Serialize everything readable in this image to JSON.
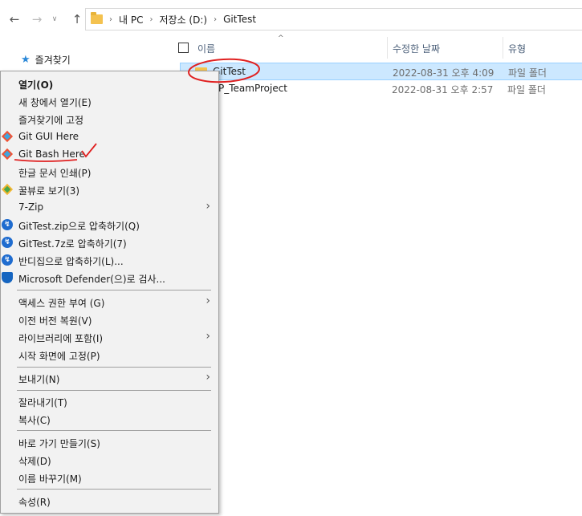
{
  "address": {
    "crumbs": [
      "내 PC",
      "저장소 (D:)",
      "GitTest"
    ],
    "separator": "›"
  },
  "nav": {
    "back": "←",
    "forward": "→",
    "recent": "∨",
    "up": "↑",
    "quick_access": "즐겨찾기"
  },
  "filelist": {
    "columns": {
      "name": "이름",
      "modified": "수정한 날짜",
      "type": "유형"
    },
    "rows": [
      {
        "name": "GitTest",
        "modified": "2022-08-31 오후 4:09",
        "type": "파일 폴더"
      },
      {
        "name": "P_TeamProject",
        "modified": "2022-08-31 오후 2:57",
        "type": "파일 폴더"
      }
    ]
  },
  "context_menu": {
    "items": [
      {
        "label": "열기(O)"
      },
      {
        "label": "새 창에서 열기(E)"
      },
      {
        "label": "즐겨찾기에 고정"
      },
      {
        "label": "Git GUI Here"
      },
      {
        "label": "Git Bash Here"
      },
      {
        "label": "한글 문서 인쇄(P)"
      },
      {
        "label": "꿀뷰로 보기(3)"
      },
      {
        "label": "7-Zip"
      },
      {
        "label": "GitTest.zip으로 압축하기(Q)"
      },
      {
        "label": "GitTest.7z로 압축하기(7)"
      },
      {
        "label": "반디집으로 압축하기(L)..."
      },
      {
        "label": "Microsoft Defender(으)로 검사..."
      },
      {
        "label": "액세스 권한 부여 (G)"
      },
      {
        "label": "이전 버전 복원(V)"
      },
      {
        "label": "라이브러리에 포함(I)"
      },
      {
        "label": "시작 화면에 고정(P)"
      },
      {
        "label": "보내기(N)"
      },
      {
        "label": "잘라내기(T)"
      },
      {
        "label": "복사(C)"
      },
      {
        "label": "바로 가기 만들기(S)"
      },
      {
        "label": "삭제(D)"
      },
      {
        "label": "이름 바꾸기(M)"
      },
      {
        "label": "속성(R)"
      }
    ],
    "submenu_arrow": "›"
  },
  "icons": {
    "git": "git-icon",
    "honeyview": "honeyview-icon",
    "bandizip": "bandizip-icon",
    "defender": "defender-icon"
  },
  "colors": {
    "selection": "#cce8ff",
    "annotation": "#e02020"
  }
}
